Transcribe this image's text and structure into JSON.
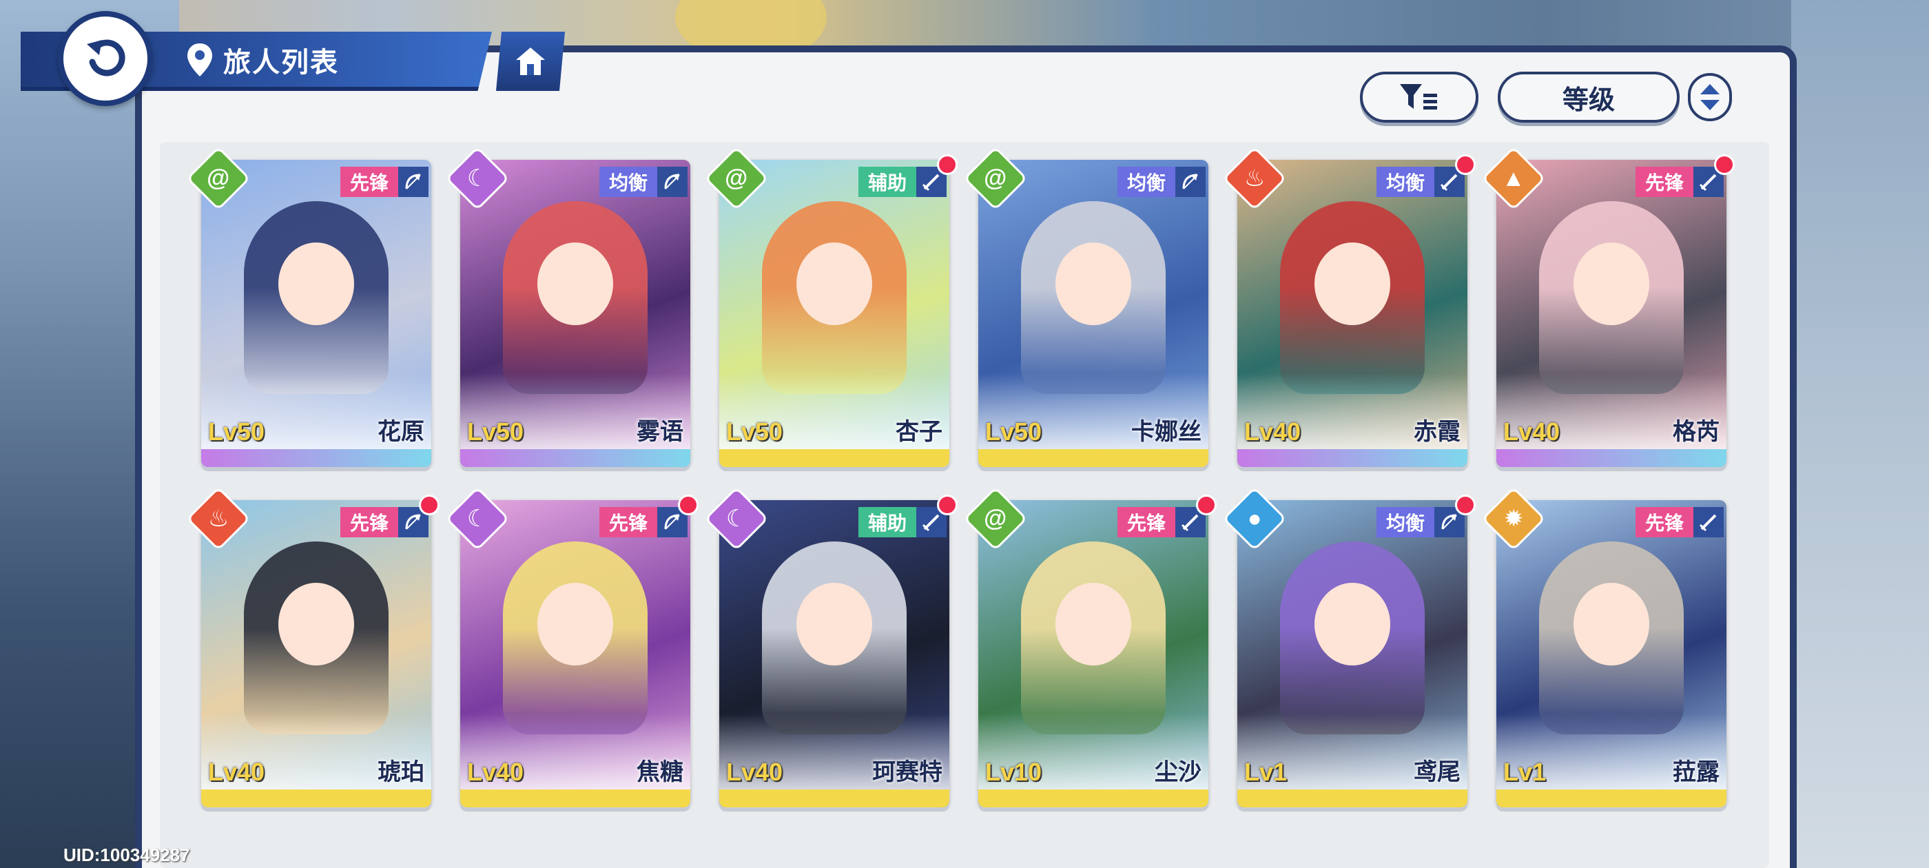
{
  "header": {
    "title": "旅人列表",
    "back_icon": "back-arrow-icon",
    "location_icon": "map-pin-icon",
    "home_icon": "home-icon"
  },
  "controls": {
    "filter_icon": "filter-icon",
    "sort_label": "等级",
    "order_icon": "sort-order-icon"
  },
  "colors": {
    "accent_dark": "#2a3d6b",
    "red_dot": "#f0294f",
    "level_text": "#f6d34a"
  },
  "roles": {
    "vanguard": {
      "label": "先锋",
      "color": "#e94f8f"
    },
    "balance": {
      "label": "均衡",
      "color": "#6a6ee0"
    },
    "support": {
      "label": "辅助",
      "color": "#3fbf8f"
    }
  },
  "characters": [
    {
      "name": "花原",
      "level": "Lv50",
      "element": "wind",
      "element_color": "#5fb33e",
      "element_glyph": "@",
      "role": "先锋",
      "role_color": "#e94f8f",
      "weapon": "bow-icon",
      "new": false,
      "palette": [
        "#8cb0ea",
        "#2d3c74",
        "#c8cde0"
      ],
      "strip": "linear-gradient(90deg,#c57be6,#7fd7ec)"
    },
    {
      "name": "雾语",
      "level": "Lv50",
      "element": "moon",
      "element_color": "#b066d8",
      "element_glyph": "☾",
      "role": "均衡",
      "role_color": "#6a6ee0",
      "weapon": "bow-icon",
      "new": false,
      "palette": [
        "#d48ad8",
        "#e05a5a",
        "#4a2c6c"
      ],
      "strip": "linear-gradient(90deg,#c57be6,#7fd7ec)"
    },
    {
      "name": "杏子",
      "level": "Lv50",
      "element": "wind",
      "element_color": "#5fb33e",
      "element_glyph": "@",
      "role": "辅助",
      "role_color": "#3fbf8f",
      "weapon": "sword-icon",
      "new": true,
      "palette": [
        "#9fd7f2",
        "#ee8a4d",
        "#d9e88a"
      ],
      "strip": "linear-gradient(90deg,#f3d94a,#f3d94a)"
    },
    {
      "name": "卡娜丝",
      "level": "Lv50",
      "element": "wind",
      "element_color": "#5fb33e",
      "element_glyph": "@",
      "role": "均衡",
      "role_color": "#6a6ee0",
      "weapon": "bow-icon",
      "new": false,
      "palette": [
        "#7aa2de",
        "#cfd2dc",
        "#3a5ea8"
      ],
      "strip": "linear-gradient(90deg,#f3d94a,#f3d94a)"
    },
    {
      "name": "赤霞",
      "level": "Lv40",
      "element": "fire",
      "element_color": "#e8553a",
      "element_glyph": "♨",
      "role": "均衡",
      "role_color": "#6a6ee0",
      "weapon": "sword-icon",
      "new": true,
      "palette": [
        "#d9b58a",
        "#c63a3a",
        "#2c6e6a"
      ],
      "strip": "linear-gradient(90deg,#c57be6,#7fd7ec)"
    },
    {
      "name": "格芮",
      "level": "Lv40",
      "element": "earth",
      "element_color": "#e8883a",
      "element_glyph": "▲",
      "role": "先锋",
      "role_color": "#e94f8f",
      "weapon": "sword-icon",
      "new": true,
      "palette": [
        "#e8a6b6",
        "#f0c6cf",
        "#4a4a58"
      ],
      "strip": "linear-gradient(90deg,#c57be6,#7fd7ec)"
    },
    {
      "name": "琥珀",
      "level": "Lv40",
      "element": "fire",
      "element_color": "#e8553a",
      "element_glyph": "♨",
      "role": "先锋",
      "role_color": "#e94f8f",
      "weapon": "bow-icon",
      "new": true,
      "palette": [
        "#8fc6e8",
        "#2a2e3a",
        "#e8d0a6"
      ],
      "strip": "linear-gradient(90deg,#f3d94a,#f3d94a)"
    },
    {
      "name": "焦糖",
      "level": "Lv40",
      "element": "moon",
      "element_color": "#b066d8",
      "element_glyph": "☾",
      "role": "先锋",
      "role_color": "#e94f8f",
      "weapon": "bow-icon",
      "new": true,
      "palette": [
        "#e6a8e0",
        "#f3e07a",
        "#7a3ca0"
      ],
      "strip": "linear-gradient(90deg,#f3d94a,#f3d94a)"
    },
    {
      "name": "珂赛特",
      "level": "Lv40",
      "element": "moon",
      "element_color": "#b066d8",
      "element_glyph": "☾",
      "role": "辅助",
      "role_color": "#3fbf8f",
      "weapon": "sword-icon",
      "new": true,
      "palette": [
        "#3a4a8a",
        "#d8dce6",
        "#1a1e2e"
      ],
      "strip": "linear-gradient(90deg,#f3d94a,#f3d94a)"
    },
    {
      "name": "尘沙",
      "level": "Lv10",
      "element": "wind",
      "element_color": "#5fb33e",
      "element_glyph": "@",
      "role": "先锋",
      "role_color": "#e94f8f",
      "weapon": "sword-icon",
      "new": true,
      "palette": [
        "#8fc0e0",
        "#f3e0a0",
        "#3a7a4a"
      ],
      "strip": "linear-gradient(90deg,#f3d94a,#f3d94a)"
    },
    {
      "name": "鸢尾",
      "level": "Lv1",
      "element": "water",
      "element_color": "#3aa0e0",
      "element_glyph": "●",
      "role": "均衡",
      "role_color": "#6a6ee0",
      "weapon": "bow-icon",
      "new": true,
      "palette": [
        "#8ab8de",
        "#8a6ad0",
        "#3a3a52"
      ],
      "strip": "linear-gradient(90deg,#f3d94a,#f3d94a)"
    },
    {
      "name": "菈露",
      "level": "Lv1",
      "element": "light",
      "element_color": "#eaa53a",
      "element_glyph": "✹",
      "role": "先锋",
      "role_color": "#e94f8f",
      "weapon": "sword-icon",
      "new": false,
      "palette": [
        "#a6c8ea",
        "#c8c0b6",
        "#2a3c7a"
      ],
      "strip": "linear-gradient(90deg,#f3d94a,#f3d94a)"
    }
  ],
  "footer": {
    "uid": "UID:100349287"
  }
}
